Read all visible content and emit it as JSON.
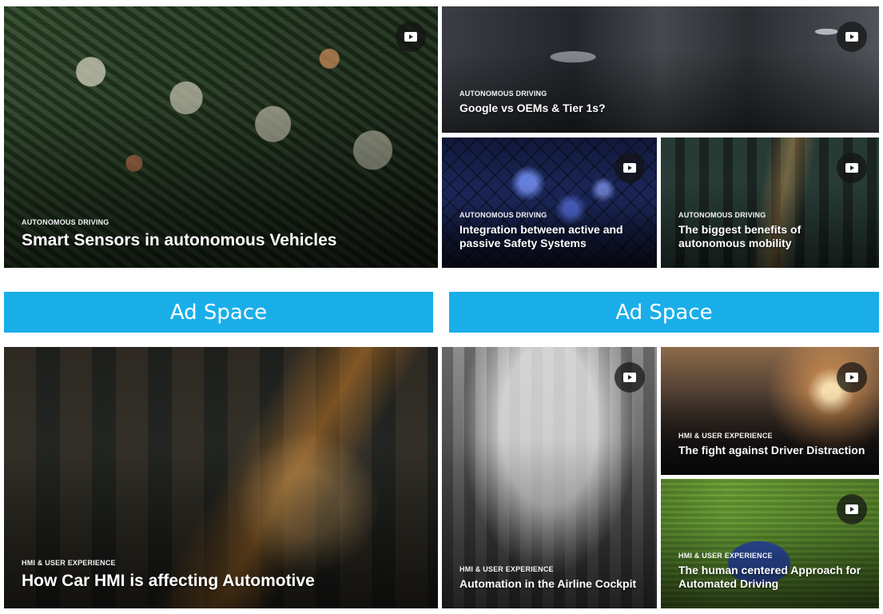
{
  "tiles": [
    {
      "category": "AUTONOMOUS DRIVING",
      "title": "Smart Sensors in autonomous Vehicles"
    },
    {
      "category": "AUTONOMOUS DRIVING",
      "title": "Google vs OEMs & Tier 1s?"
    },
    {
      "category": "AUTONOMOUS DRIVING",
      "title": "Integration between active and passive Safety Systems"
    },
    {
      "category": "AUTONOMOUS DRIVING",
      "title": "The biggest benefits of autonomous mobility"
    },
    {
      "category": "HMI & USER EXPERIENCE",
      "title": "How Car HMI is affecting Automotive"
    },
    {
      "category": "HMI & USER EXPERIENCE",
      "title": "Automation in the Airline Cockpit"
    },
    {
      "category": "HMI & USER EXPERIENCE",
      "title": "The fight against Driver Distraction"
    },
    {
      "category": "HMI & USER EXPERIENCE",
      "title": "The human centered Approach for Automated Driving"
    }
  ],
  "ads": {
    "left": "Ad Space",
    "right": "Ad Space"
  },
  "icons": {
    "play": "video-play-icon"
  },
  "colors": {
    "ad_background": "#1aaee9",
    "text": "#ffffff"
  }
}
